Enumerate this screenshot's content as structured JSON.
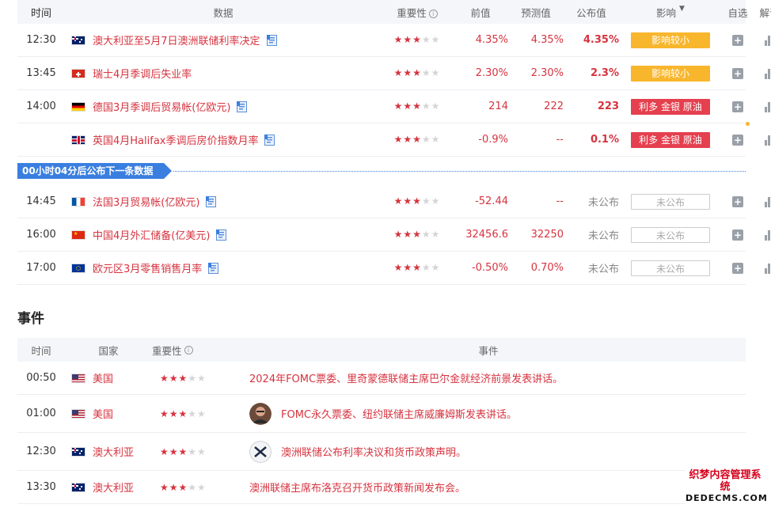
{
  "header": {
    "time": "时间",
    "data": "数据",
    "importance": "重要性",
    "prev": "前值",
    "forecast": "预测值",
    "published": "公布值",
    "effect": "影响",
    "fav": "自选",
    "read": "解读"
  },
  "rows": [
    {
      "time": "12:30",
      "flag": "au",
      "name": "澳大利亚至5月7日澳洲联储利率决定",
      "stars": 3,
      "prev": "4.35%",
      "forecast": "4.35%",
      "published": "4.35%",
      "effect": "影响较小",
      "effect_type": "yellow"
    },
    {
      "time": "13:45",
      "flag": "ch",
      "name": "瑞士4月季调后失业率",
      "stars": 3,
      "prev": "2.30%",
      "forecast": "2.30%",
      "published": "2.3%",
      "effect": "影响较小",
      "effect_type": "yellow"
    },
    {
      "time": "14:00",
      "flag": "de",
      "name": "德国3月季调后贸易帐(亿欧元)",
      "stars": 3,
      "prev": "214",
      "forecast": "222",
      "published": "223",
      "effect": "利多 金银 原油",
      "effect_type": "red"
    },
    {
      "time": "",
      "flag": "gb",
      "name": "英国4月Halifax季调后房价指数月率",
      "stars": 3,
      "prev": "-0.9%",
      "forecast": "--",
      "published": "0.1%",
      "effect": "利多 金银 原油",
      "effect_type": "red"
    }
  ],
  "next_release": "00小时04分后公布下一条数据",
  "rows2": [
    {
      "time": "14:45",
      "flag": "fr",
      "name": "法国3月贸易帐(亿欧元)",
      "stars": 3,
      "prev": "-52.44",
      "forecast": "--",
      "published": "未公布",
      "effect": "未公布",
      "effect_type": "empty"
    },
    {
      "time": "16:00",
      "flag": "cn",
      "name": "中国4月外汇储备(亿美元)",
      "stars": 3,
      "prev": "32456.6",
      "forecast": "32250",
      "published": "未公布",
      "effect": "未公布",
      "effect_type": "empty"
    },
    {
      "time": "17:00",
      "flag": "eu",
      "name": "欧元区3月零售销售月率",
      "stars": 3,
      "prev": "-0.50%",
      "forecast": "0.70%",
      "published": "未公布",
      "effect": "未公布",
      "effect_type": "empty"
    }
  ],
  "events_title": "事件",
  "events_header": {
    "time": "时间",
    "country": "国家",
    "importance": "重要性",
    "event": "事件"
  },
  "events": [
    {
      "time": "00:50",
      "flag": "us",
      "country": "美国",
      "stars": 3,
      "avatar": "none",
      "text": "2024年FOMC票委、里奇蒙德联储主席巴尔金就经济前景发表讲话。"
    },
    {
      "time": "01:00",
      "flag": "us",
      "country": "美国",
      "stars": 3,
      "avatar": "person",
      "text": "FOMC永久票委、纽约联储主席威廉姆斯发表讲话。"
    },
    {
      "time": "12:30",
      "flag": "au",
      "country": "澳大利亚",
      "stars": 3,
      "avatar": "rba-logo",
      "text": "澳洲联储公布利率决议和货币政策声明。"
    },
    {
      "time": "13:30",
      "flag": "au",
      "country": "澳大利亚",
      "stars": 3,
      "avatar": "none",
      "text": "澳洲联储主席布洛克召开货币政策新闻发布会。"
    }
  ],
  "watermark": {
    "line1": "织梦内容管理系统",
    "line2": "DEDECMS.COM"
  },
  "colors": {
    "accent_red": "#d6333f",
    "badge_yellow": "#f8b62d",
    "badge_red": "#e5404f",
    "blue": "#3a7fe0"
  }
}
